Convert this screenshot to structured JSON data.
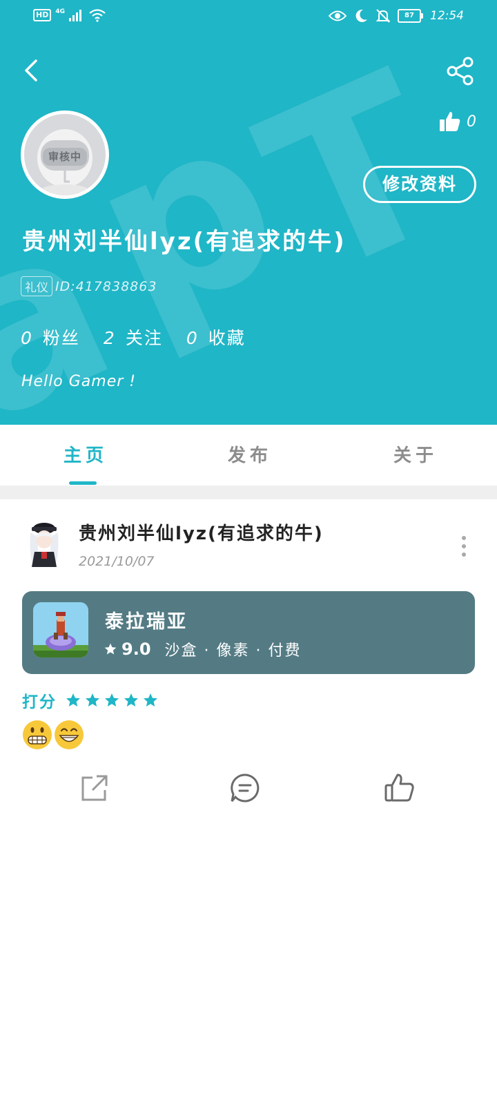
{
  "statusbar": {
    "hd": "HD",
    "network": "4G",
    "battery": "87",
    "time": "12:54",
    "icons": [
      "signal-icon",
      "wifi-icon",
      "eye-icon",
      "moon-icon",
      "bell-off-icon",
      "battery-icon"
    ]
  },
  "header": {
    "back_icon": "chevron-left-icon",
    "share_icon": "share-icon",
    "like_icon": "thumbs-up-icon",
    "like_count": "0",
    "avatar_review_tag": "审核中",
    "edit_button": "修改资料",
    "username": "贵州刘半仙lyz(有追求的牛)",
    "badge": "礼仪",
    "user_id": "ID:417838863",
    "stats": [
      {
        "count": "0",
        "label": "粉丝"
      },
      {
        "count": "2",
        "label": "关注"
      },
      {
        "count": "0",
        "label": "收藏"
      }
    ],
    "greeting": "Hello Gamer !",
    "accent": "#1fb6c7"
  },
  "tabs": [
    {
      "label": "主页",
      "active": true
    },
    {
      "label": "发布",
      "active": false
    },
    {
      "label": "关于",
      "active": false
    }
  ],
  "post": {
    "author": "贵州刘半仙lyz(有追求的牛)",
    "date": "2021/10/07",
    "more_icon": "more-vertical-icon",
    "game": {
      "title": "泰拉瑞亚",
      "score": "9.0",
      "tags": "沙盒 · 像素 · 付费",
      "card_color": "#547b84"
    },
    "rating_label": "打分",
    "rating_stars": 5,
    "emojis": [
      "grimacing-face-emoji",
      "grinning-face-emoji"
    ],
    "actions": [
      "external-share-icon",
      "comment-icon",
      "thumbs-up-icon"
    ]
  }
}
